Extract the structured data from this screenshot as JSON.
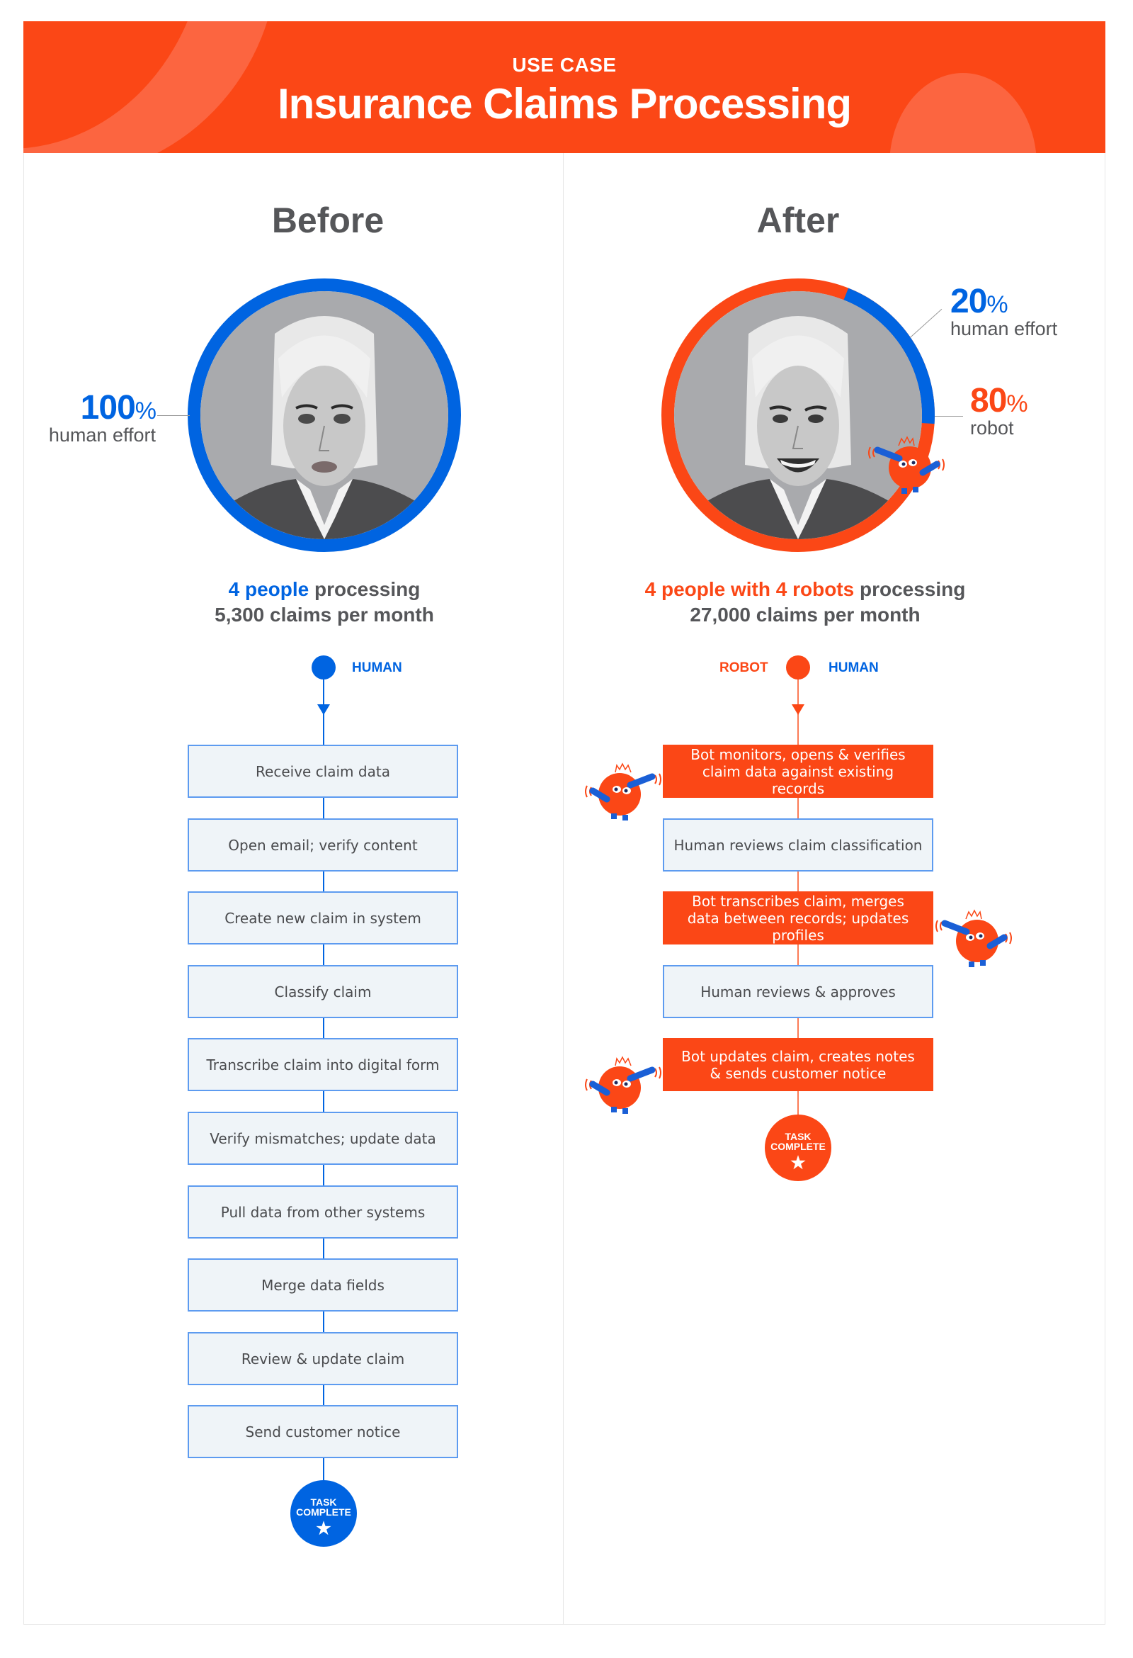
{
  "header": {
    "eyebrow": "USE CASE",
    "title": "Insurance Claims Processing"
  },
  "colors": {
    "brand_orange": "#fb4716",
    "human_blue": "#0064e1",
    "text_gray": "#555659",
    "box_fill": "#eff4f8",
    "box_border": "#5d9bf0"
  },
  "before": {
    "heading": "Before",
    "effort": {
      "human_pct": 100,
      "robot_pct": 0
    },
    "stat": {
      "value": "100",
      "unit": "%",
      "label": "human effort"
    },
    "caption": {
      "highlight": "4 people",
      "rest": " processing",
      "line2": "5,300 claims per month"
    },
    "legend": {
      "human": "HUMAN"
    },
    "steps": [
      {
        "actor": "human",
        "text": "Receive claim data"
      },
      {
        "actor": "human",
        "text": "Open email; verify content"
      },
      {
        "actor": "human",
        "text": "Create new claim in system"
      },
      {
        "actor": "human",
        "text": "Classify claim"
      },
      {
        "actor": "human",
        "text": "Transcribe claim into digital form"
      },
      {
        "actor": "human",
        "text": "Verify mismatches; update data"
      },
      {
        "actor": "human",
        "text": "Pull data from other systems"
      },
      {
        "actor": "human",
        "text": "Merge data fields"
      },
      {
        "actor": "human",
        "text": "Review & update claim"
      },
      {
        "actor": "human",
        "text": "Send customer notice"
      }
    ],
    "complete": {
      "line1": "TASK",
      "line2": "COMPLETE",
      "icon": "star-icon"
    }
  },
  "after": {
    "heading": "After",
    "effort": {
      "human_pct": 20,
      "robot_pct": 80
    },
    "stat_human": {
      "value": "20",
      "unit": "%",
      "label": "human effort"
    },
    "stat_robot": {
      "value": "80",
      "unit": "%",
      "label": "robot"
    },
    "caption": {
      "highlight": "4 people with 4 robots",
      "rest": " processing",
      "line2": "27,000 claims per month"
    },
    "legend": {
      "robot": "ROBOT",
      "human": "HUMAN"
    },
    "steps": [
      {
        "actor": "bot",
        "text": "Bot monitors, opens & verifies claim data against existing records"
      },
      {
        "actor": "human",
        "text": "Human reviews claim classification"
      },
      {
        "actor": "bot",
        "text": "Bot transcribes claim, merges data between records; updates profiles"
      },
      {
        "actor": "human",
        "text": "Human reviews & approves"
      },
      {
        "actor": "bot",
        "text": "Bot updates claim, creates notes & sends customer notice"
      }
    ],
    "complete": {
      "line1": "TASK",
      "line2": "COMPLETE",
      "icon": "star-icon"
    }
  }
}
